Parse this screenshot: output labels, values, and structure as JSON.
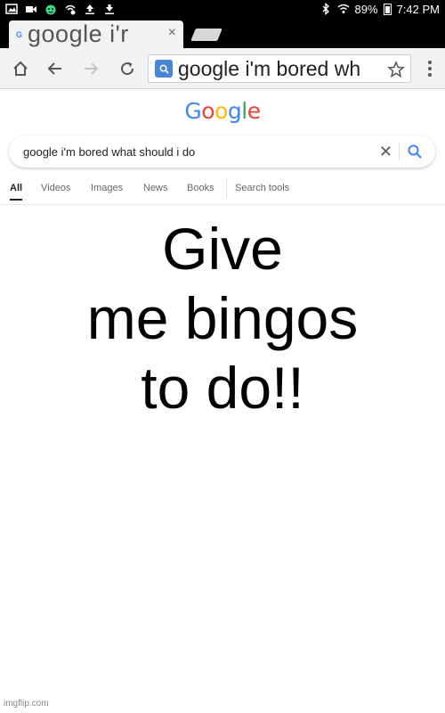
{
  "status_bar": {
    "battery": "89%",
    "time": "7:42 PM",
    "icons": [
      "image-icon",
      "video-icon",
      "android-icon",
      "wifi-sync-icon",
      "upload-icon",
      "download-icon",
      "bluetooth-icon",
      "signal-icon",
      "battery-icon"
    ]
  },
  "browser": {
    "tab_title": "google i'r",
    "tab_close": "×",
    "favicon": "G",
    "omnibox_text": "google i'm bored wh"
  },
  "google": {
    "logo_letters": [
      {
        "ch": "G",
        "color": "#4285F4"
      },
      {
        "ch": "o",
        "color": "#EA4335"
      },
      {
        "ch": "o",
        "color": "#FBBC05"
      },
      {
        "ch": "g",
        "color": "#4285F4"
      },
      {
        "ch": "l",
        "color": "#34A853"
      },
      {
        "ch": "e",
        "color": "#EA4335"
      }
    ],
    "query": "google i'm bored what should i do",
    "clear": "✕",
    "tabs": [
      "All",
      "Videos",
      "Images",
      "News",
      "Books",
      "Search tools"
    ],
    "active_tab": "All"
  },
  "meme": {
    "lines": [
      "Give",
      "me bingos",
      "to do!!"
    ]
  },
  "watermark": "imgflip.com"
}
